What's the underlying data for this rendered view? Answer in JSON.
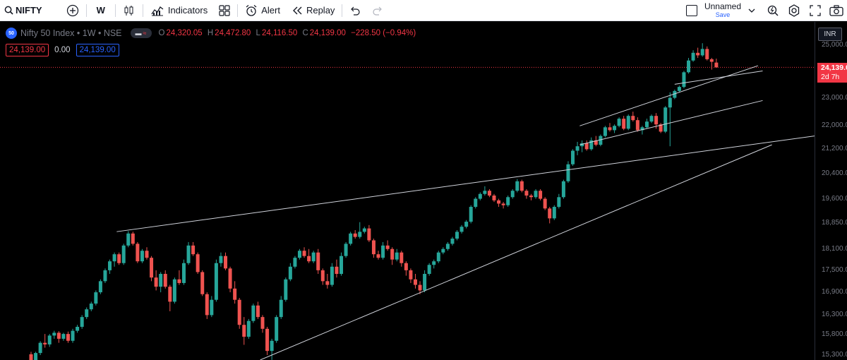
{
  "toolbar": {
    "symbol": "NIFTY",
    "interval": "W",
    "indicators_label": "Indicators",
    "alert_label": "Alert",
    "replay_label": "Replay",
    "layout_name": "Unnamed",
    "save_label": "Save"
  },
  "legend": {
    "badge": "50",
    "title": "Nifty 50 Index • 1W • NSE",
    "pill_a": "▬",
    "pill_b": "≈",
    "open_key": "O",
    "open": "24,320.05",
    "high_key": "H",
    "high": "24,472.80",
    "low_key": "L",
    "low": "24,116.50",
    "close_key": "C",
    "close": "24,139.00",
    "change": "−228.50 (−0.94%)",
    "bid": "24,139.00",
    "spread": "0.00",
    "ask": "24,139.00"
  },
  "price_scale": {
    "currency": "INR",
    "last_price": "24,139.0",
    "countdown": "2d 7h",
    "ticks": [
      "25,000.0",
      "23,000.0",
      "22,000.0",
      "21,200.0",
      "20,400.0",
      "19,600.0",
      "18,850.0",
      "18,100.0",
      "17,500.0",
      "16,900.0",
      "16,300.0",
      "15,800.0",
      "15,300.0"
    ]
  },
  "colors": {
    "up": "#26a69a",
    "down": "#ef5350",
    "trendline": "#d1d4dc",
    "last_price_line": "#f23645"
  },
  "chart_data": {
    "type": "candlestick",
    "scale": "log",
    "ylim": [
      15150,
      25400
    ],
    "last_price": 24139,
    "candles": [
      [
        15320,
        15380,
        15150,
        15170
      ],
      [
        15170,
        15380,
        15120,
        15350
      ],
      [
        15350,
        15640,
        15300,
        15600
      ],
      [
        15600,
        15820,
        15480,
        15560
      ],
      [
        15560,
        15820,
        15500,
        15780
      ],
      [
        15780,
        15900,
        15700,
        15850
      ],
      [
        15850,
        15890,
        15600,
        15700
      ],
      [
        15700,
        15850,
        15650,
        15820
      ],
      [
        15820,
        15880,
        15600,
        15650
      ],
      [
        15650,
        15950,
        15600,
        15900
      ],
      [
        15900,
        16050,
        15850,
        16000
      ],
      [
        16000,
        16300,
        15950,
        16250
      ],
      [
        16250,
        16500,
        16200,
        16450
      ],
      [
        16450,
        16650,
        16400,
        16600
      ],
      [
        16600,
        16950,
        16550,
        16900
      ],
      [
        16900,
        17250,
        16850,
        17200
      ],
      [
        17200,
        17550,
        17150,
        17500
      ],
      [
        17500,
        17800,
        17400,
        17750
      ],
      [
        17750,
        18000,
        17600,
        17950
      ],
      [
        17950,
        18000,
        17650,
        17700
      ],
      [
        17700,
        18250,
        17650,
        18200
      ],
      [
        18200,
        18620,
        18150,
        18550
      ],
      [
        18550,
        18604,
        18200,
        18250
      ],
      [
        18250,
        18300,
        17700,
        17750
      ],
      [
        17750,
        18100,
        17700,
        18050
      ],
      [
        18050,
        18150,
        17800,
        17850
      ],
      [
        17850,
        17900,
        17200,
        17300
      ],
      [
        17300,
        17500,
        16950,
        17050
      ],
      [
        17050,
        17450,
        16900,
        17400
      ],
      [
        17400,
        17500,
        17000,
        17050
      ],
      [
        17050,
        17100,
        16400,
        16650
      ],
      [
        16650,
        17300,
        16600,
        17250
      ],
      [
        17250,
        17500,
        17100,
        17150
      ],
      [
        17150,
        17800,
        17100,
        17700
      ],
      [
        17700,
        18300,
        17650,
        18200
      ],
      [
        18200,
        18300,
        17900,
        17950
      ],
      [
        17950,
        18000,
        17400,
        17450
      ],
      [
        17450,
        17500,
        16800,
        16850
      ],
      [
        16850,
        16900,
        16200,
        16300
      ],
      [
        16300,
        16800,
        16250,
        16700
      ],
      [
        16700,
        17800,
        16650,
        17700
      ],
      [
        17700,
        18000,
        17600,
        17900
      ],
      [
        17900,
        18000,
        17500,
        17550
      ],
      [
        17550,
        17600,
        16900,
        17000
      ],
      [
        17000,
        17200,
        16600,
        16700
      ],
      [
        16700,
        16750,
        15950,
        16050
      ],
      [
        16050,
        16250,
        15550,
        15750
      ],
      [
        15750,
        16200,
        15700,
        16150
      ],
      [
        16150,
        16600,
        16100,
        16550
      ],
      [
        16550,
        16650,
        16200,
        16250
      ],
      [
        16250,
        16300,
        15850,
        15950
      ],
      [
        15950,
        16000,
        15300,
        15400
      ],
      [
        15400,
        15700,
        15183,
        15650
      ],
      [
        15650,
        16300,
        15600,
        16250
      ],
      [
        16250,
        16800,
        16200,
        16700
      ],
      [
        16700,
        17300,
        16650,
        17250
      ],
      [
        17250,
        17700,
        17200,
        17600
      ],
      [
        17600,
        17900,
        17550,
        17850
      ],
      [
        17850,
        18100,
        17800,
        18050
      ],
      [
        18050,
        18150,
        17850,
        17900
      ],
      [
        17900,
        18100,
        17700,
        17750
      ],
      [
        17750,
        18050,
        17700,
        18000
      ],
      [
        18000,
        18100,
        17400,
        17500
      ],
      [
        17500,
        17550,
        17100,
        17200
      ],
      [
        17200,
        17400,
        17000,
        17100
      ],
      [
        17100,
        17700,
        17050,
        17600
      ],
      [
        17600,
        17800,
        17300,
        17400
      ],
      [
        17400,
        18000,
        17350,
        17900
      ],
      [
        17900,
        18300,
        17850,
        18250
      ],
      [
        18250,
        18600,
        18200,
        18550
      ],
      [
        18550,
        18650,
        18400,
        18450
      ],
      [
        18450,
        18887,
        18400,
        18600
      ],
      [
        18600,
        18750,
        18550,
        18700
      ],
      [
        18700,
        18800,
        18300,
        18350
      ],
      [
        18350,
        18400,
        17850,
        17950
      ],
      [
        17950,
        18050,
        17800,
        17850
      ],
      [
        17850,
        18300,
        17800,
        18200
      ],
      [
        18200,
        18350,
        18050,
        18100
      ],
      [
        18100,
        18150,
        17650,
        17800
      ],
      [
        17800,
        18100,
        17750,
        18000
      ],
      [
        18000,
        18050,
        17600,
        17700
      ],
      [
        17700,
        17750,
        17350,
        17500
      ],
      [
        17500,
        17550,
        17150,
        17250
      ],
      [
        17250,
        17400,
        17000,
        17100
      ],
      [
        17100,
        17200,
        16850,
        16950
      ],
      [
        16950,
        17500,
        16900,
        17400
      ],
      [
        17400,
        17700,
        17350,
        17650
      ],
      [
        17650,
        17800,
        17550,
        17750
      ],
      [
        17750,
        18050,
        17700,
        18000
      ],
      [
        18000,
        18150,
        17950,
        18100
      ],
      [
        18100,
        18300,
        18050,
        18250
      ],
      [
        18250,
        18450,
        18200,
        18400
      ],
      [
        18400,
        18650,
        18350,
        18600
      ],
      [
        18600,
        18800,
        18550,
        18750
      ],
      [
        18750,
        18950,
        18700,
        18900
      ],
      [
        18900,
        19400,
        18850,
        19350
      ],
      [
        19350,
        19650,
        19300,
        19600
      ],
      [
        19600,
        19800,
        19550,
        19750
      ],
      [
        19750,
        19991,
        19700,
        19850
      ],
      [
        19850,
        19900,
        19650,
        19700
      ],
      [
        19700,
        19750,
        19500,
        19550
      ],
      [
        19550,
        19600,
        19350,
        19450
      ],
      [
        19450,
        19500,
        19300,
        19400
      ],
      [
        19400,
        19700,
        19350,
        19650
      ],
      [
        19650,
        19900,
        19600,
        19850
      ],
      [
        19850,
        20222,
        19800,
        20150
      ],
      [
        20150,
        20200,
        19800,
        19850
      ],
      [
        19850,
        19900,
        19600,
        19700
      ],
      [
        19700,
        19750,
        19550,
        19650
      ],
      [
        19650,
        19900,
        19600,
        19850
      ],
      [
        19850,
        19900,
        19550,
        19600
      ],
      [
        19600,
        19650,
        19250,
        19300
      ],
      [
        19300,
        19350,
        18850,
        19000
      ],
      [
        19000,
        19400,
        18950,
        19350
      ],
      [
        19350,
        19750,
        19300,
        19650
      ],
      [
        19650,
        20200,
        19600,
        20150
      ],
      [
        20150,
        20800,
        20100,
        20700
      ],
      [
        20700,
        21200,
        20650,
        21150
      ],
      [
        21150,
        21450,
        21000,
        21300
      ],
      [
        21300,
        21500,
        21100,
        21400
      ],
      [
        21400,
        21500,
        21150,
        21200
      ],
      [
        21200,
        21600,
        21150,
        21500
      ],
      [
        21500,
        21650,
        21300,
        21350
      ],
      [
        21350,
        21700,
        21300,
        21650
      ],
      [
        21650,
        22000,
        21600,
        21950
      ],
      [
        21950,
        22100,
        21800,
        21850
      ],
      [
        21850,
        22050,
        21750,
        22000
      ],
      [
        22000,
        22300,
        21950,
        22250
      ],
      [
        22250,
        22350,
        21850,
        21900
      ],
      [
        21900,
        22400,
        21850,
        22350
      ],
      [
        22350,
        22500,
        22150,
        22200
      ],
      [
        22200,
        22300,
        21800,
        21850
      ],
      [
        21850,
        22000,
        21700,
        21950
      ],
      [
        21950,
        22250,
        21900,
        22150
      ],
      [
        22150,
        22400,
        22100,
        22350
      ],
      [
        22350,
        22450,
        21900,
        22050
      ],
      [
        22050,
        22100,
        21750,
        21800
      ],
      [
        21800,
        22700,
        21750,
        22650
      ],
      [
        22650,
        23200,
        21300,
        23000
      ],
      [
        23000,
        23300,
        22950,
        23250
      ],
      [
        23250,
        23450,
        23200,
        23400
      ],
      [
        23400,
        24000,
        23350,
        23950
      ],
      [
        23950,
        24500,
        23900,
        24400
      ],
      [
        24400,
        24800,
        24350,
        24700
      ],
      [
        24700,
        24900,
        24500,
        24600
      ],
      [
        24600,
        25078,
        24550,
        24850
      ],
      [
        24850,
        24950,
        24400,
        24450
      ],
      [
        24450,
        24500,
        24050,
        24350
      ],
      [
        24320,
        24473,
        24117,
        24139
      ]
    ]
  }
}
